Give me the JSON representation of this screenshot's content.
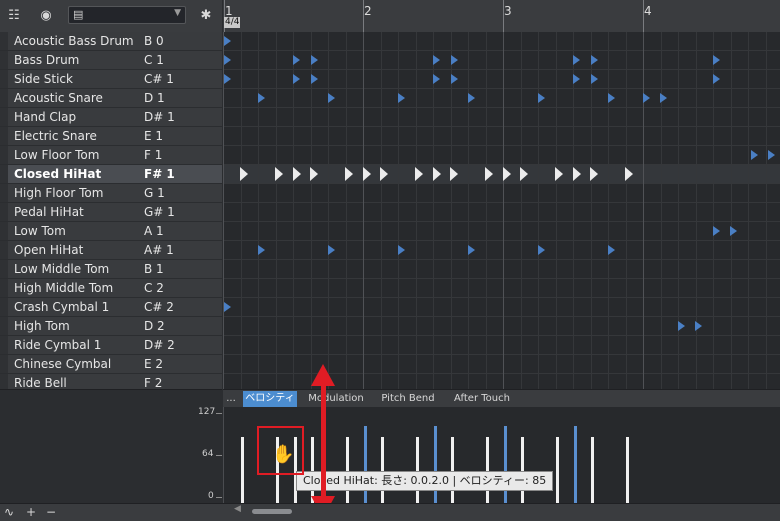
{
  "toolbar": {
    "preset_value": "",
    "icons": [
      "track-list-icon",
      "drum-icon",
      "document-icon",
      "dropdown-arrow-icon",
      "wrench-icon"
    ]
  },
  "ruler": {
    "bars": [
      "1",
      "2",
      "3",
      "4"
    ],
    "time_signature": "4/4"
  },
  "instruments": [
    {
      "name": "Acoustic Bass Drum",
      "note": "B 0"
    },
    {
      "name": "Bass Drum",
      "note": "C 1"
    },
    {
      "name": "Side Stick",
      "note": "C# 1"
    },
    {
      "name": "Acoustic Snare",
      "note": "D 1"
    },
    {
      "name": "Hand Clap",
      "note": "D# 1"
    },
    {
      "name": "Electric Snare",
      "note": "E 1"
    },
    {
      "name": "Low Floor Tom",
      "note": "F 1"
    },
    {
      "name": "Closed HiHat",
      "note": "F# 1",
      "selected": true
    },
    {
      "name": "High Floor Tom",
      "note": "G 1"
    },
    {
      "name": "Pedal HiHat",
      "note": "G# 1"
    },
    {
      "name": "Low Tom",
      "note": "A 1"
    },
    {
      "name": "Open HiHat",
      "note": "A# 1"
    },
    {
      "name": "Low Middle Tom",
      "note": "B 1"
    },
    {
      "name": "High Middle Tom",
      "note": "C 2"
    },
    {
      "name": "Crash Cymbal 1",
      "note": "C# 2"
    },
    {
      "name": "High Tom",
      "note": "D 2"
    },
    {
      "name": "Ride Cymbal 1",
      "note": "D# 2"
    },
    {
      "name": "Chinese Cymbal",
      "note": "E 2"
    },
    {
      "name": "Ride Bell",
      "note": "F 2"
    }
  ],
  "tabs": {
    "more": "...",
    "items": [
      "ベロシティ",
      "Modulation",
      "Pitch Bend",
      "After Touch"
    ],
    "active_index": 0
  },
  "velocity_scale": {
    "max": "127",
    "mid": "64",
    "min": "0"
  },
  "tooltip": {
    "text": "Closed HiHat:  長さ: 0.0.2.0 | ベロシティー: 85"
  },
  "statusbar": {
    "icons": [
      "automation-icon",
      "plus-icon",
      "minus-icon"
    ],
    "plus": "+",
    "minus": "−"
  },
  "colors": {
    "accent": "#4c8dd0",
    "note_blue": "#4a7fc4",
    "highlight_red": "#e01c24"
  }
}
